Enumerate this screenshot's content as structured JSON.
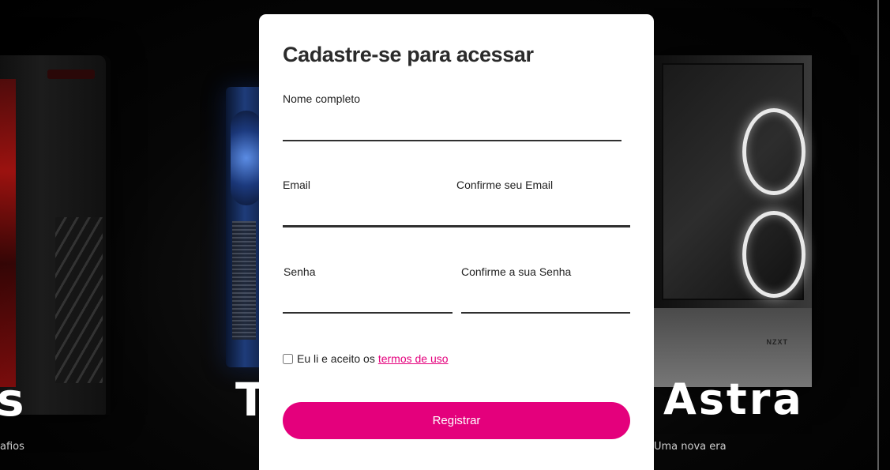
{
  "background": {
    "large_text_left": "s",
    "large_text_mid": "T",
    "large_text_right": "Astra",
    "tagline_left": "afios",
    "tagline_right": "Uma nova era",
    "case_logo": "NZXT"
  },
  "form": {
    "title": "Cadastre-se para acessar",
    "fields": {
      "full_name": {
        "label": "Nome completo",
        "value": ""
      },
      "email": {
        "label": "Email",
        "value": ""
      },
      "confirm_email": {
        "label": "Confirme seu Email",
        "value": ""
      },
      "password": {
        "label": "Senha",
        "value": ""
      },
      "confirm_password": {
        "label": "Confirme a sua Senha",
        "value": ""
      }
    },
    "terms": {
      "checked": false,
      "text": "Eu li e aceito os",
      "link_text": "termos de uso"
    },
    "submit_label": "Registrar"
  },
  "colors": {
    "accent": "#e4007c",
    "card_background": "#ffffff",
    "page_background": "#000000"
  }
}
